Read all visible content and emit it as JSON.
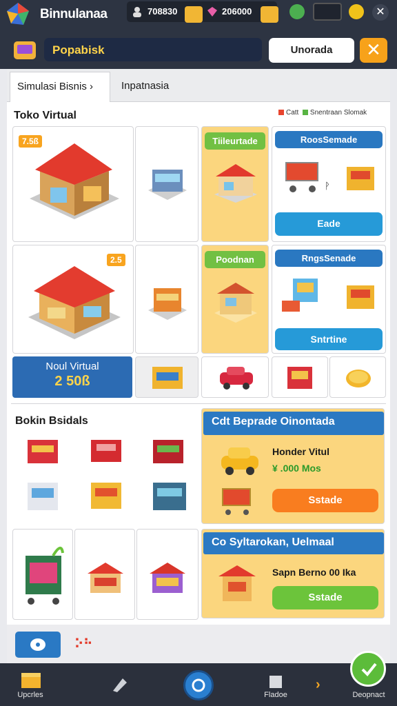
{
  "app": {
    "name": "Binnulanaa"
  },
  "resources": {
    "r1": "708830",
    "r2": "206000"
  },
  "header": {
    "search_value": "Popabisk",
    "upgrade_label": "Unorada",
    "close_label": "✕"
  },
  "tabs": [
    {
      "label": "Simulasi Bisnis ›"
    },
    {
      "label": "Inpatnasia"
    }
  ],
  "section1": {
    "title": "Toko Virtual",
    "legend": [
      {
        "label": "Catt",
        "color": "#e8452e"
      },
      {
        "label": "Snentraan Slomak",
        "color": "#58b443"
      }
    ],
    "badge1": "7.5ß",
    "badge2": "2.5",
    "card_label_1": "Tiileurtade",
    "card_label_2": "Poodnan",
    "blue_label_1": "RoosSemade",
    "blue_label_2": "RngsSenade",
    "blue_btn_1": "Eade",
    "blue_btn_2": "Sntrtine",
    "small_label": "ᚹ",
    "coin_title": "Noul Virtual",
    "coin_value": "2 50ß"
  },
  "section2": {
    "title": "Bokin Bsidals",
    "promo1": {
      "header": "Cdt Beprade Oinontada",
      "name": "Honder Vitul",
      "price": "¥ .000 Mos",
      "button": "Sstade"
    },
    "promo2": {
      "header": "Co Syltarokan, Uelmaal",
      "name": "Sapn Berno 00 Ika",
      "button": "Sstade"
    }
  },
  "nav": {
    "items": [
      {
        "label": "Upcrles"
      },
      {
        "label": "Fladoe"
      },
      {
        "label": "Deopnact"
      }
    ]
  },
  "colors": {
    "top_bg": "#2d3442",
    "accent_orange": "#f97d1f",
    "accent_green": "#6cc43b",
    "accent_blue": "#2a78c1"
  }
}
